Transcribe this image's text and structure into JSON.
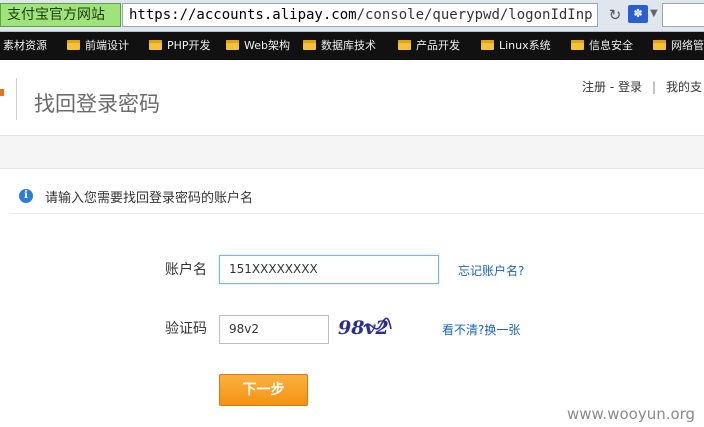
{
  "browser": {
    "site_tag": "支付宝官方网站",
    "url_host": "https://accounts.alipay.com",
    "url_path": "/console/querypwd/logonIdInp",
    "search_engine_icon": "paw-icon"
  },
  "bookmarks": [
    {
      "label": "素材资源",
      "folder": false
    },
    {
      "label": "前端设计",
      "folder": true
    },
    {
      "label": "PHP开发",
      "folder": true
    },
    {
      "label": "Web架构",
      "folder": true
    },
    {
      "label": "数据库技术",
      "folder": true
    },
    {
      "label": "产品开发",
      "folder": true
    },
    {
      "label": "Linux系统",
      "folder": true
    },
    {
      "label": "信息安全",
      "folder": true
    },
    {
      "label": "网络管",
      "folder": true
    }
  ],
  "header": {
    "title": "找回登录密码",
    "register": "注册",
    "dash": " - ",
    "login": "登录",
    "sep": "|",
    "mine": "我的支"
  },
  "form": {
    "instruction": "请输入您需要找回登录密码的账户名",
    "account_label": "账户名",
    "account_value": "151XXXXXXXX",
    "forgot_link": "忘记账户名?",
    "captcha_label": "验证码",
    "captcha_value": "98v2",
    "captcha_image_text": "98v2",
    "refresh_link": "看不清?换一张",
    "next_button": "下一步"
  },
  "watermark": "www.wooyun.org",
  "colors": {
    "accent_orange": "#f39311",
    "link_blue": "#1a64b4",
    "site_tag_green": "#9fe37a",
    "info_blue": "#2d7dd2"
  }
}
